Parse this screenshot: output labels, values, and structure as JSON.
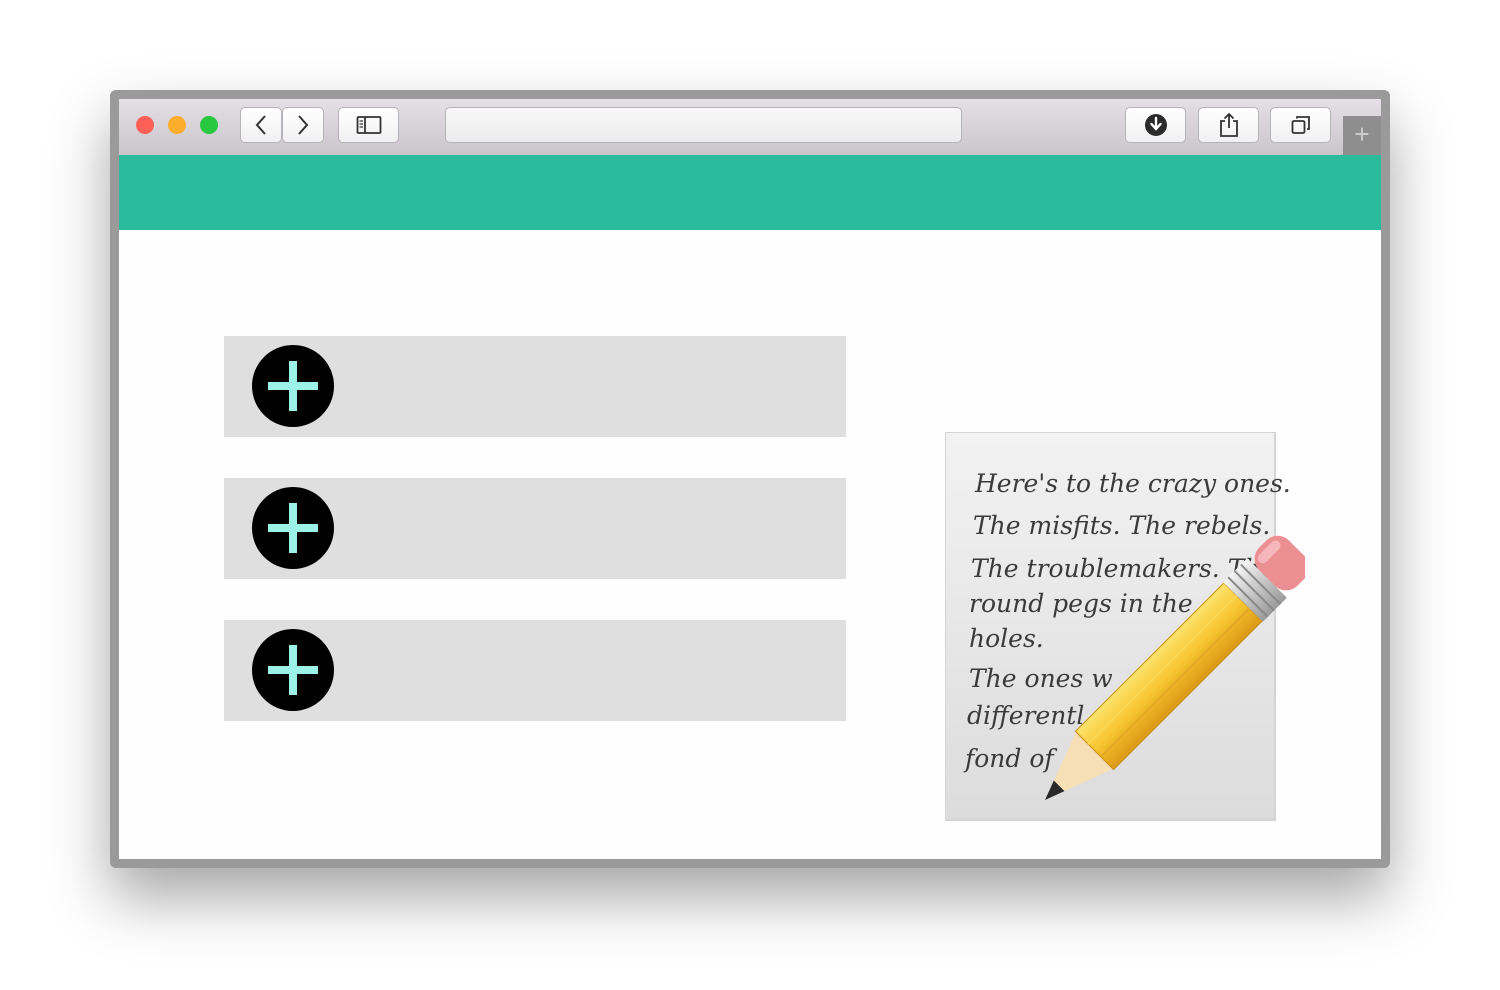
{
  "browser": {
    "url": "",
    "new_tab_symbol": "+",
    "lights": {
      "close": "#fe5f57",
      "minimize": "#fdad2c",
      "zoom": "#28c840"
    },
    "icons": [
      "back-chevron-icon",
      "forward-chevron-icon",
      "sidebar-icon",
      "download-icon",
      "share-icon",
      "tabs-overview-icon"
    ]
  },
  "colors": {
    "header": "#2abb9c",
    "row": "#dfdfdf",
    "plus_bg": "#000000",
    "plus_fg": "#9cf2e6"
  },
  "list": {
    "items": [
      {
        "icon": "add-circle-icon",
        "label": ""
      },
      {
        "icon": "add-circle-icon",
        "label": ""
      },
      {
        "icon": "add-circle-icon",
        "label": ""
      }
    ]
  },
  "illustration": {
    "icon": "memo-pencil-icon",
    "handwriting": [
      "Here's to the crazy ones.",
      "The misfits. The rebels.",
      "The troublemakers. The",
      "round pegs in the",
      "holes.",
      "The ones w",
      "differentl",
      "fond of"
    ]
  }
}
